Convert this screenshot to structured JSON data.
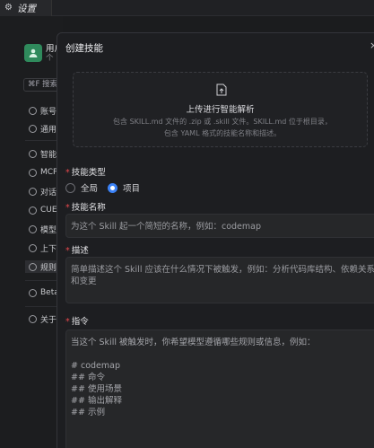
{
  "window": {
    "tab_label": "设置",
    "tab_icon": "gear-icon"
  },
  "sidebar": {
    "user": {
      "name": "用户",
      "subtitle": "个"
    },
    "search_label": "⌘F 搜索",
    "items": [
      {
        "label": "账号",
        "icon": "person-icon"
      },
      {
        "label": "通用",
        "icon": "settings-icon"
      },
      {
        "label": "智能",
        "icon": "sparkle-icon"
      },
      {
        "label": "MCP",
        "icon": "plug-icon"
      },
      {
        "label": "对话",
        "icon": "chat-icon"
      },
      {
        "label": "CUE",
        "icon": "cursor-icon"
      },
      {
        "label": "模型",
        "icon": "cube-icon"
      },
      {
        "label": "上下",
        "icon": "layers-icon"
      },
      {
        "label": "规则",
        "icon": "rules-icon"
      },
      {
        "label": "Beta",
        "icon": "flask-icon"
      },
      {
        "label": "关于",
        "icon": "info-icon"
      }
    ]
  },
  "modal": {
    "title": "创建技能",
    "upload": {
      "title": "上传进行智能解析",
      "description": "包含 SKILL.md 文件的 .zip 或 .skill 文件。SKILL.md 位于根目录，包含 YAML 格式的技能名称和描述。"
    },
    "skill_type": {
      "label": "技能类型",
      "options": [
        {
          "label": "全局",
          "checked": false
        },
        {
          "label": "项目",
          "checked": true
        }
      ]
    },
    "skill_name": {
      "label": "技能名称",
      "placeholder": "为这个 Skill 起一个简短的名称，例如：codemap"
    },
    "description": {
      "label": "描述",
      "placeholder": "简单描述这个 Skill 应该在什么情况下被触发，例如：分析代码库结构、依赖关系和变更"
    },
    "instructions": {
      "label": "指令",
      "placeholder_lines": [
        "当这个 Skill 被触发时，你希望模型遵循哪些规则或信息，例如：",
        "",
        "# codemap",
        "## 命令",
        "## 使用场景",
        "## 输出解释",
        "## 示例"
      ]
    }
  },
  "colors": {
    "accent": "#3b82f6",
    "required": "#e5484d",
    "avatar": "#2f8a5c"
  }
}
